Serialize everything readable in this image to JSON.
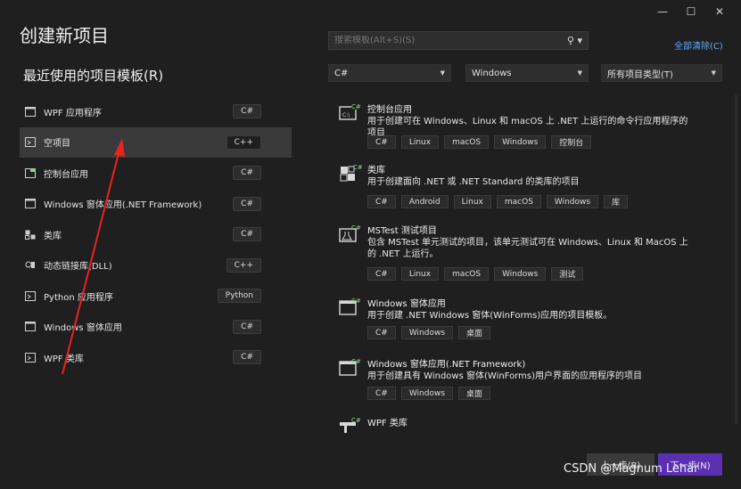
{
  "window": {
    "minimize": "—",
    "maximize": "☐",
    "close": "✕"
  },
  "page_title": "创建新项目",
  "recent_title": "最近使用的项目模板(R)",
  "recent": [
    {
      "label": "WPF 应用程序",
      "lang": "C#",
      "icon": "wpf-app-icon"
    },
    {
      "label": "空项目",
      "lang": "C++",
      "icon": "empty-project-icon"
    },
    {
      "label": "控制台应用",
      "lang": "C#",
      "icon": "console-app-icon"
    },
    {
      "label": "Windows 窗体应用(.NET Framework)",
      "lang": "C#",
      "icon": "winforms-icon"
    },
    {
      "label": "类库",
      "lang": "C#",
      "icon": "class-library-icon"
    },
    {
      "label": "动态链接库(DLL)",
      "lang": "C++",
      "icon": "dll-icon"
    },
    {
      "label": "Python 应用程序",
      "lang": "Python",
      "icon": "python-app-icon"
    },
    {
      "label": "Windows 窗体应用",
      "lang": "C#",
      "icon": "winforms-icon"
    },
    {
      "label": "WPF 类库",
      "lang": "C#",
      "icon": "wpf-library-icon"
    }
  ],
  "search": {
    "placeholder": "搜索模板(Alt+S)(S)"
  },
  "clear_all": "全部清除(C)",
  "filters": {
    "language": "C#",
    "platform": "Windows",
    "project_type": "所有项目类型(T)"
  },
  "templates": [
    {
      "name": "控制台应用",
      "desc": "用于创建可在 Windows、Linux 和 macOS 上 .NET 上运行的命令行应用程序的项目",
      "tags": [
        "C#",
        "Linux",
        "macOS",
        "Windows",
        "控制台"
      ]
    },
    {
      "name": "类库",
      "desc": "用于创建面向 .NET 或 .NET Standard 的类库的项目",
      "tags": [
        "C#",
        "Android",
        "Linux",
        "macOS",
        "Windows",
        "库"
      ]
    },
    {
      "name": "MSTest 测试项目",
      "desc": "包含 MSTest 单元测试的项目，该单元测试可在 Windows、Linux 和 MacOS 上的 .NET 上运行。",
      "tags": [
        "C#",
        "Linux",
        "macOS",
        "Windows",
        "测试"
      ]
    },
    {
      "name": "Windows 窗体应用",
      "desc": "用于创建 .NET Windows 窗体(WinForms)应用的项目模板。",
      "tags": [
        "C#",
        "Windows",
        "桌面"
      ]
    },
    {
      "name": "Windows 窗体应用(.NET Framework)",
      "desc": "用于创建具有 Windows 窗体(WinForms)用户界面的应用程序的项目",
      "tags": [
        "C#",
        "Windows",
        "桌面"
      ]
    },
    {
      "name": "WPF 类库",
      "desc": "",
      "tags": []
    }
  ],
  "buttons": {
    "prev": "上一步(B)",
    "next": "下一步(N)"
  },
  "watermark": "CSDN @Magnum Lehar",
  "colors": {
    "accent": "#5b2fb2",
    "link": "#5ea8ff",
    "annotation": "#e8231e"
  }
}
